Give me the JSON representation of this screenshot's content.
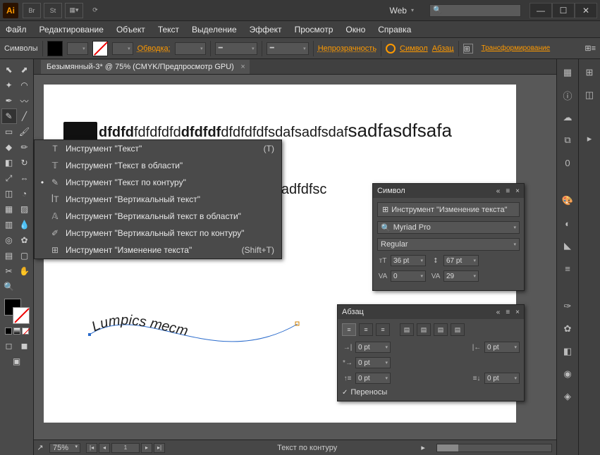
{
  "titlebar": {
    "logo": "Ai",
    "icon_br": "Br",
    "icon_st": "St",
    "workspace": "Web"
  },
  "menu": [
    "Файл",
    "Редактирование",
    "Объект",
    "Текст",
    "Выделение",
    "Эффект",
    "Просмотр",
    "Окно",
    "Справка"
  ],
  "ctrl": {
    "symbols": "Символы",
    "stroke": "Обводка:",
    "opacity": "Непрозрачность",
    "links": [
      "Символ",
      "Абзац"
    ],
    "transform": "Трансформирование"
  },
  "doc_tab": "Безымянный-3* @ 75% (CMYK/Предпросмотр GPU)",
  "canvas": {
    "line1_bold1": "dfdfd",
    "line1_plain1": "fdfdfdfd",
    "line1_bold2": "dfdfdf",
    "line1_plain2": "dfdfdfdf",
    "line1_plain3": "sdafsadfsdaf",
    "line1_big": "sadfasdfsafa",
    "line2": "fdfdfsadfdfsc",
    "curve": "Lumpics тест"
  },
  "flyout": [
    {
      "mk": "",
      "ic": "T",
      "lbl": "Инструмент \"Текст\"",
      "sc": "(T)"
    },
    {
      "mk": "",
      "ic": "𝕋",
      "lbl": "Инструмент \"Текст в области\"",
      "sc": ""
    },
    {
      "mk": "•",
      "ic": "✎",
      "lbl": "Инструмент \"Текст по контуру\"",
      "sc": ""
    },
    {
      "mk": "",
      "ic": "ꟾT",
      "lbl": "Инструмент \"Вертикальный текст\"",
      "sc": ""
    },
    {
      "mk": "",
      "ic": "𝔸",
      "lbl": "Инструмент \"Вертикальный текст в области\"",
      "sc": ""
    },
    {
      "mk": "",
      "ic": "✐",
      "lbl": "Инструмент \"Вертикальный текст по контуру\"",
      "sc": ""
    },
    {
      "mk": "",
      "ic": "⊞",
      "lbl": "Инструмент \"Изменение текста\"",
      "sc": "(Shift+T)"
    }
  ],
  "char_panel": {
    "title": "Символ",
    "touch": "Инструмент \"Изменение текста\"",
    "font": "Myriad Pro",
    "style": "Regular",
    "size": "36 pt",
    "leading": "67 pt",
    "kern": "0",
    "track": "29"
  },
  "para_panel": {
    "title": "Абзац",
    "l": "0 pt",
    "r": "0 pt",
    "fl": "0 pt",
    "sb": "0 pt",
    "sa": "0 pt",
    "hyphen": "Переносы"
  },
  "status": {
    "zoom": "75%",
    "page": "1",
    "label": "Текст по контуру"
  }
}
